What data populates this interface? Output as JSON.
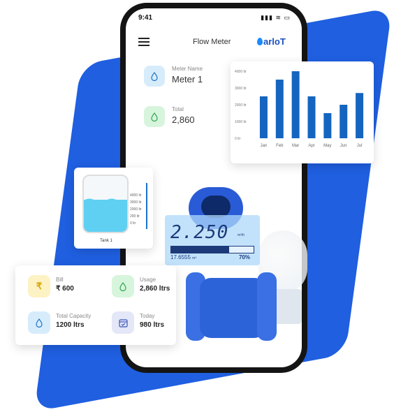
{
  "statusbar": {
    "time": "9:41",
    "icons": "▮▮▮ ≋ ▭"
  },
  "header": {
    "title": "Flow Meter",
    "logo_text": "arloT"
  },
  "meter": {
    "name_label": "Meter Name",
    "name_value": "Meter 1",
    "total_label": "Total",
    "total_value": "2,860"
  },
  "chart_data": {
    "type": "bar",
    "categories": [
      "Jan",
      "Feb",
      "Mar",
      "Apr",
      "May",
      "Jun",
      "Jul"
    ],
    "values": [
      2500,
      3500,
      4000,
      2500,
      1500,
      2000,
      2700
    ],
    "ylim": [
      0,
      4000
    ],
    "yticks": [
      "4000 ltr",
      "3000 ltr",
      "2000 ltr",
      "1000 ltr",
      "0 ltr"
    ],
    "color": "#1565c0"
  },
  "tank": {
    "label": "Tank 1",
    "scale": [
      "4000 ltr",
      "3000 ltr",
      "2000 ltr",
      "200 ltr",
      "0 ltr"
    ],
    "level": 0.58
  },
  "display": {
    "reading": "2.250",
    "unit": "m³/h",
    "total": "17.6555",
    "total_unit": "m³",
    "percent": "70%",
    "fill": 0.7
  },
  "summary": {
    "bill_label": "Bill",
    "bill_value": "₹ 600",
    "usage_label": "Usage",
    "usage_value": "2,860 ltrs",
    "capacity_label": "Total Capacity",
    "capacity_value": "1200 ltrs",
    "today_label": "Today",
    "today_value": "980 ltrs"
  },
  "icons": {
    "rupee": "rupee-icon",
    "drop": "water-drop-icon",
    "calendar": "calendar-icon"
  },
  "colors": {
    "accent_blue": "#1f5fe0",
    "bar_blue": "#1565c0",
    "water": "#5fd0f2"
  }
}
